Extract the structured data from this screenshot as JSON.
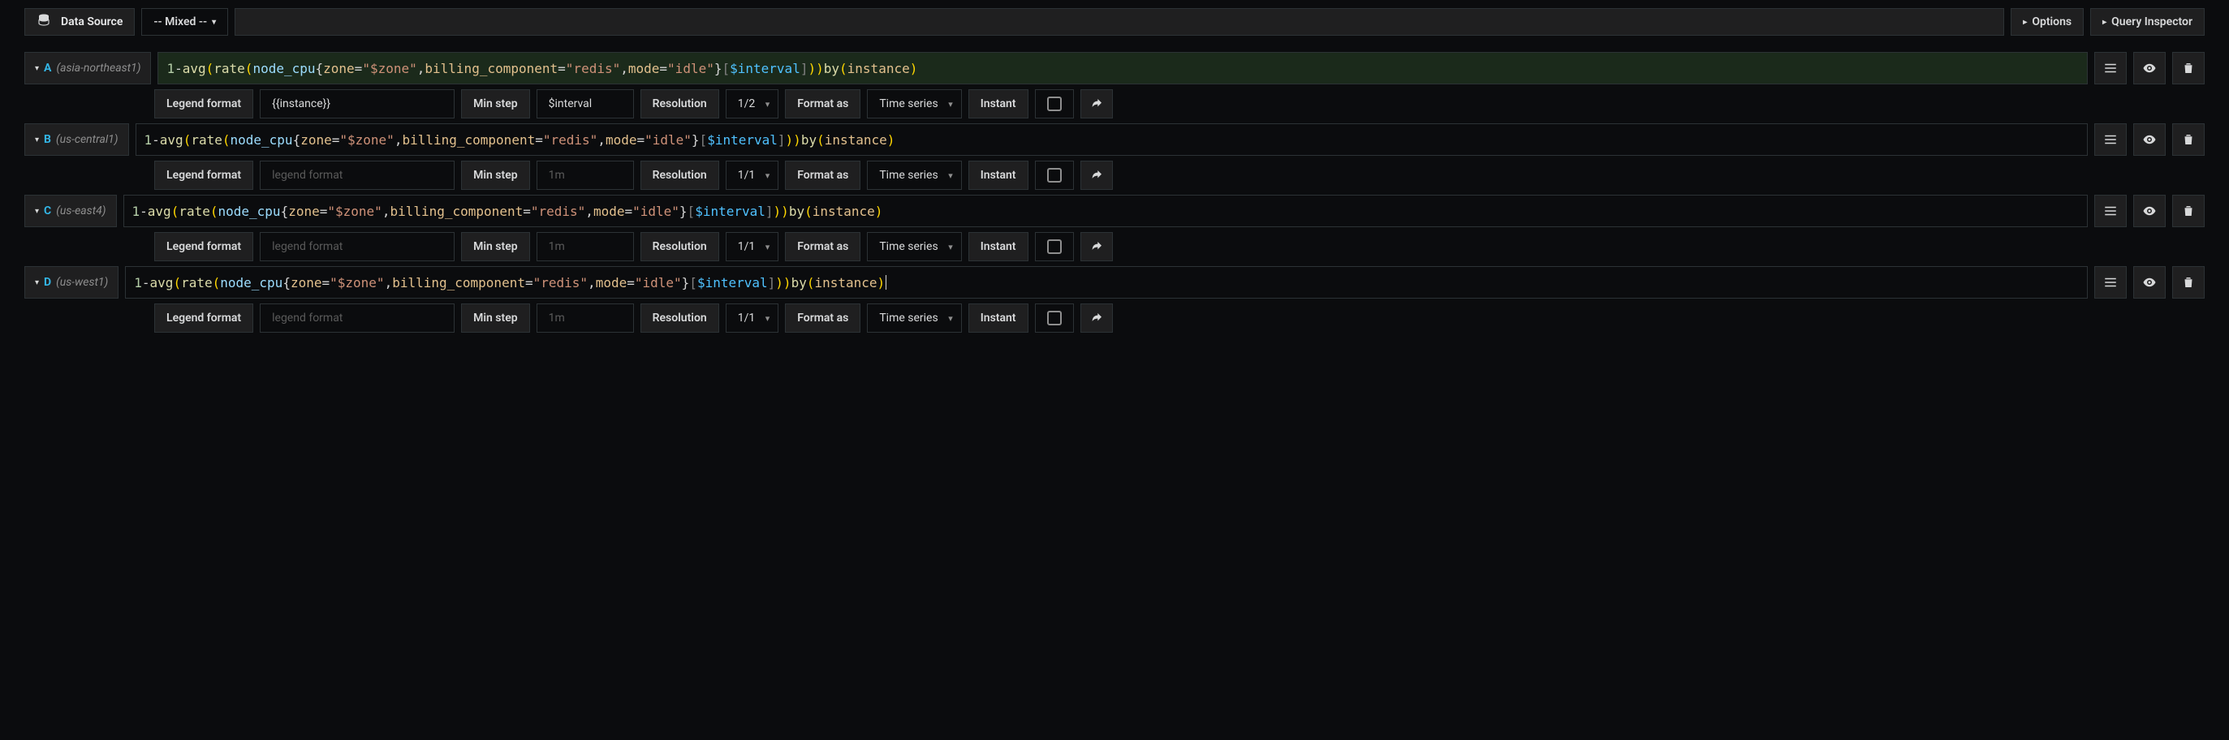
{
  "topbar": {
    "data_source_label": "Data Source",
    "mixed_label": "-- Mixed --",
    "options_label": "Options",
    "inspector_label": "Query Inspector"
  },
  "row_labels": {
    "legend_format": "Legend format",
    "min_step": "Min step",
    "resolution": "Resolution",
    "format_as": "Format as",
    "instant": "Instant"
  },
  "queries": [
    {
      "letter": "A",
      "zone": "(asia-northeast1)",
      "highlight": true,
      "expr": "1 - avg(rate(node_cpu{zone=\"$zone\",billing_component=\"redis\",mode=\"idle\"}[$interval])) by(instance)",
      "legend_value": "{{instance}}",
      "legend_placeholder": "",
      "min_step": "$interval",
      "min_step_is_placeholder": false,
      "resolution": "1/2",
      "format_as": "Time series",
      "instant": false,
      "cursor": false
    },
    {
      "letter": "B",
      "zone": "(us-central1)",
      "highlight": false,
      "expr": "1 - avg(rate(node_cpu{zone=\"$zone\",billing_component=\"redis\",mode=\"idle\"}[$interval])) by(instance)",
      "legend_value": "",
      "legend_placeholder": "legend format",
      "min_step": "1m",
      "min_step_is_placeholder": true,
      "resolution": "1/1",
      "format_as": "Time series",
      "instant": false,
      "cursor": false
    },
    {
      "letter": "C",
      "zone": "(us-east4)",
      "highlight": false,
      "expr": "1 - avg(rate(node_cpu{zone=\"$zone\",billing_component=\"redis\",mode=\"idle\"}[$interval])) by(instance)",
      "legend_value": "",
      "legend_placeholder": "legend format",
      "min_step": "1m",
      "min_step_is_placeholder": true,
      "resolution": "1/1",
      "format_as": "Time series",
      "instant": false,
      "cursor": false
    },
    {
      "letter": "D",
      "zone": "(us-west1)",
      "highlight": false,
      "expr": "1 - avg(rate(node_cpu{zone=\"$zone\",billing_component=\"redis\",mode=\"idle\"}[$interval])) by(instance)",
      "legend_value": "",
      "legend_placeholder": "legend format",
      "min_step": "1m",
      "min_step_is_placeholder": true,
      "resolution": "1/1",
      "format_as": "Time series",
      "instant": false,
      "cursor": true
    }
  ]
}
